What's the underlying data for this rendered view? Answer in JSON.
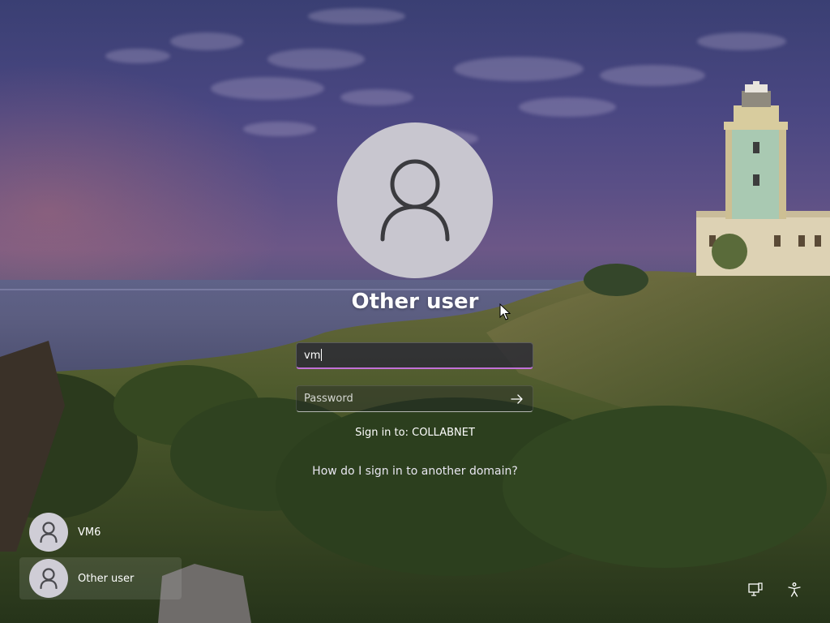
{
  "login": {
    "title": "Other user",
    "username_value": "vm",
    "password_placeholder": "Password",
    "sign_in_to": "Sign in to: COLLABNET",
    "domain_help_link": "How do I sign in to another domain?"
  },
  "user_list": [
    {
      "label": "VM6",
      "selected": false
    },
    {
      "label": "Other user",
      "selected": true
    }
  ],
  "icons": {
    "avatar": "user-silhouette-icon",
    "submit": "arrow-right-icon",
    "network": "network-icon",
    "accessibility": "accessibility-icon"
  },
  "colors": {
    "focus_underline": "#c170d8",
    "avatar_background": "#c8c6cf"
  }
}
